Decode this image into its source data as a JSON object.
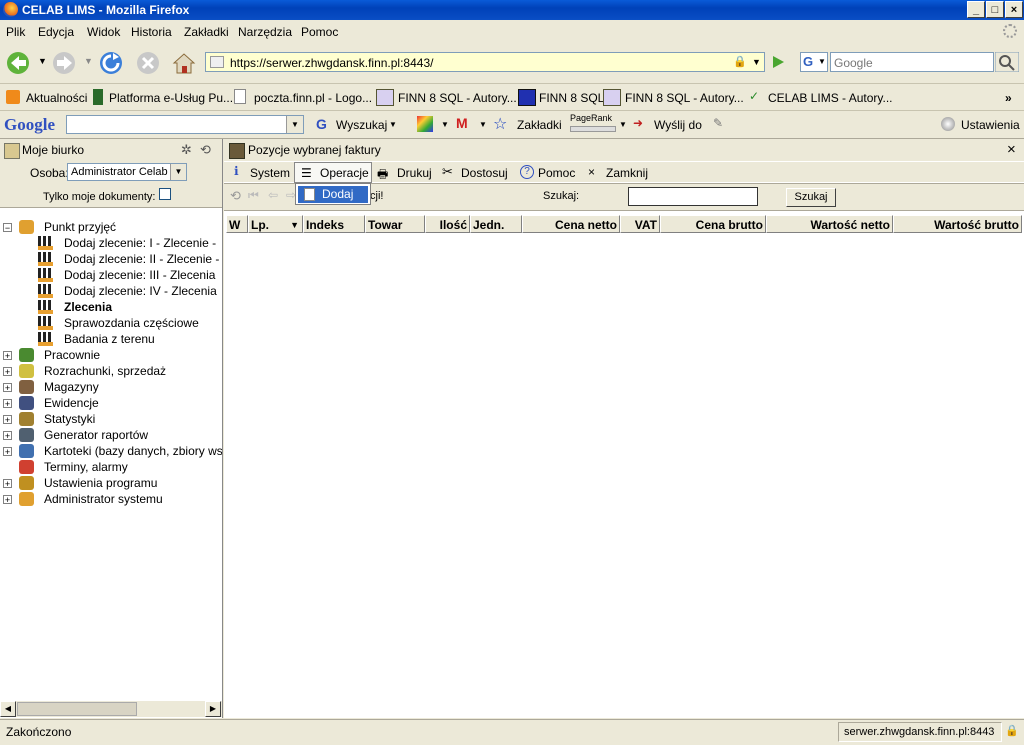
{
  "window": {
    "title": "CELAB LIMS - Mozilla Firefox",
    "min": "_",
    "max": "□",
    "close": "×"
  },
  "menu": [
    "Plik",
    "Edycja",
    "Widok",
    "Historia",
    "Zakładki",
    "Narzędzia",
    "Pomoc"
  ],
  "nav": {
    "url": "https://serwer.zhwgdansk.finn.pl:8443/",
    "search_placeholder": "Google",
    "search_engine": "G"
  },
  "bookmarks": [
    "Aktualności",
    "Platforma e-Usług Pu...",
    "poczta.finn.pl - Logo...",
    "FINN 8 SQL - Autory...",
    "FINN 8 SQL",
    "FINN 8 SQL - Autory...",
    "CELAB LIMS - Autory..."
  ],
  "bookmarks_more": "»",
  "google_bar": {
    "logo": "Google",
    "search": "Wyszukaj",
    "bookmarks": "Zakładki",
    "pagerank": "PageRank",
    "send": "Wyślij do",
    "settings": "Ustawienia"
  },
  "left_panel": {
    "title": "Moje biurko",
    "osoba_label": "Osoba:",
    "osoba_value": "Administrator Celab",
    "only_mine": "Tylko moje dokumenty:",
    "tree": [
      {
        "label": "Punkt przyjęć",
        "level": 0,
        "expanded": true,
        "bold": false
      },
      {
        "label": "Dodaj zlecenie: I - Zlecenie - ",
        "level": 1,
        "bold": false
      },
      {
        "label": "Dodaj zlecenie: II - Zlecenie - ",
        "level": 1,
        "bold": false
      },
      {
        "label": "Dodaj zlecenie: III - Zlecenia",
        "level": 1,
        "bold": false
      },
      {
        "label": "Dodaj zlecenie: IV - Zlecenia",
        "level": 1,
        "bold": false
      },
      {
        "label": "Zlecenia",
        "level": 1,
        "bold": true
      },
      {
        "label": "Sprawozdania częściowe",
        "level": 1,
        "bold": false
      },
      {
        "label": "Badania z terenu",
        "level": 1,
        "bold": false
      },
      {
        "label": "Pracownie",
        "level": 0,
        "bold": false
      },
      {
        "label": "Rozrachunki, sprzedaż",
        "level": 0,
        "bold": false
      },
      {
        "label": "Magazyny",
        "level": 0,
        "bold": false
      },
      {
        "label": "Ewidencje",
        "level": 0,
        "bold": false
      },
      {
        "label": "Statystyki",
        "level": 0,
        "bold": false
      },
      {
        "label": "Generator raportów",
        "level": 0,
        "bold": false
      },
      {
        "label": "Kartoteki (bazy danych, zbiory ws",
        "level": 0,
        "bold": false
      },
      {
        "label": "Terminy, alarmy",
        "level": 0,
        "leaf": true,
        "bold": false
      },
      {
        "label": "Ustawienia programu",
        "level": 0,
        "bold": false
      },
      {
        "label": "Administrator systemu",
        "level": 0,
        "bold": false
      }
    ]
  },
  "right_panel": {
    "title": "Pozycje wybranej faktury",
    "close": "×",
    "tabs": [
      "System",
      "Operacje",
      "Drukuj",
      "Dostosuj",
      "Pomoc",
      "Zamknij"
    ],
    "dropdown_item": "Dodaj",
    "toolbar_partial": "cji!",
    "search_label": "Szukaj:",
    "search_button": "Szukaj",
    "columns": [
      "W",
      "Lp.",
      "Indeks",
      "Towar",
      "Ilość",
      "Jedn.",
      "Cena netto",
      "VAT",
      "Cena brutto",
      "Wartość netto",
      "Wartość brutto"
    ]
  },
  "status": {
    "left": "Zakończono",
    "right": "serwer.zhwgdansk.finn.pl:8443"
  }
}
